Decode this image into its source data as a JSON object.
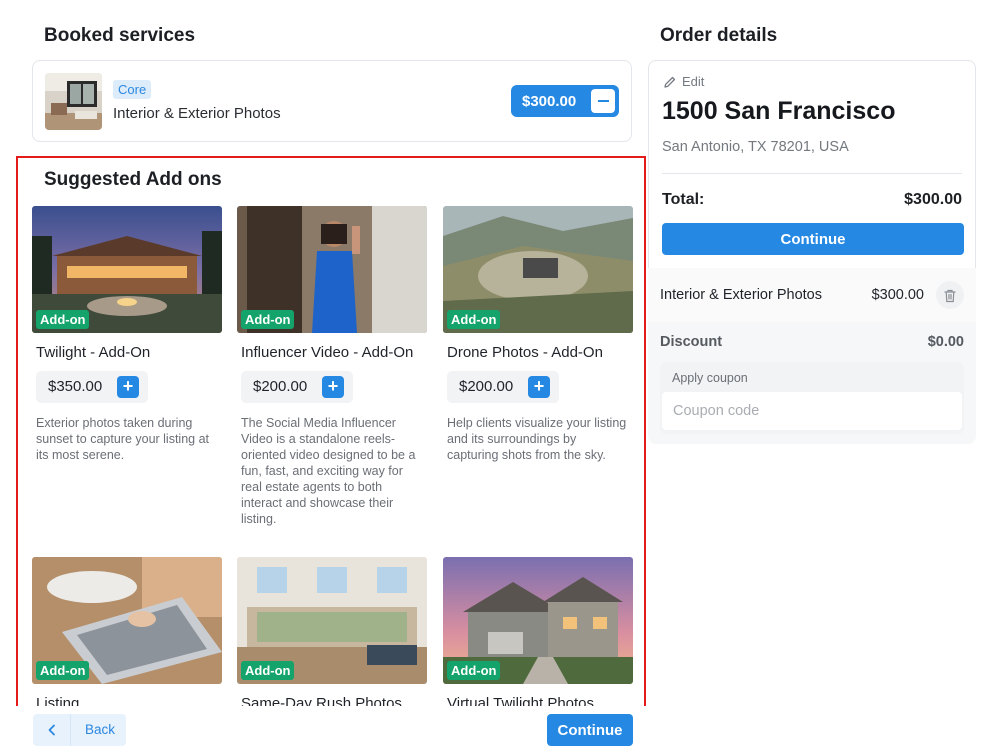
{
  "booked": {
    "heading": "Booked services",
    "service": {
      "badge": "Core",
      "name": "Interior & Exterior Photos",
      "price": "$300.00"
    }
  },
  "suggested": {
    "heading": "Suggested Add ons",
    "badge_label": "Add-on",
    "items": [
      {
        "title": "Twilight - Add-On",
        "price": "$350.00",
        "description": "Exterior photos taken during sunset to capture your listing at its most serene."
      },
      {
        "title": "Influencer Video - Add-On",
        "price": "$200.00",
        "description": "The Social Media Influencer Video is a standalone reels-oriented video designed to be a fun, fast, and exciting way for real estate agents to both interact and showcase their listing."
      },
      {
        "title": "Drone Photos - Add-On",
        "price": "$200.00",
        "description": "Help clients visualize your listing and its surroundings by capturing shots from the sky."
      },
      {
        "title": "Listing",
        "price": "",
        "description": ""
      },
      {
        "title": "Same-Day Rush Photos",
        "price": "",
        "description": ""
      },
      {
        "title": "Virtual Twilight Photos",
        "price": "",
        "description": ""
      }
    ]
  },
  "order": {
    "heading": "Order details",
    "edit_label": "Edit",
    "address_line1": "1500 San Francisco",
    "address_line2": "San Antonio, TX 78201, USA",
    "total_label": "Total:",
    "total_value": "$300.00",
    "continue_label": "Continue",
    "line_item": {
      "name": "Interior & Exterior Photos",
      "price": "$300.00"
    },
    "discount_label": "Discount",
    "discount_value": "$0.00",
    "coupon_label": "Apply coupon",
    "coupon_placeholder": "Coupon code",
    "coupon_value": ""
  },
  "footer": {
    "back_label": "Back",
    "continue_label": "Continue"
  },
  "colors": {
    "accent": "#2589e4",
    "addon_badge": "#14a36b",
    "highlight_border": "#e31b1b"
  }
}
